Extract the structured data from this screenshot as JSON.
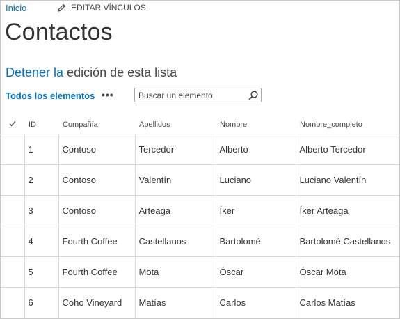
{
  "nav": {
    "home": "Inicio",
    "edit_links": "EDITAR VÍNCULOS"
  },
  "page": {
    "title": "Contactos",
    "stop_edit_link": "Detener la",
    "stop_edit_rest": " edición de esta lista"
  },
  "toolbar": {
    "view": "Todos los elementos",
    "more": "•••",
    "search_placeholder": "Buscar un elemento"
  },
  "table": {
    "columns": [
      "ID",
      "Compañía",
      "Apellidos",
      "Nombre",
      "Nombre_completo"
    ],
    "rows": [
      [
        "1",
        "Contoso",
        "Tercedor",
        "Alberto",
        "Alberto Tercedor"
      ],
      [
        "2",
        "Contoso",
        "Valentín",
        "Luciano",
        "Luciano Valentín"
      ],
      [
        "3",
        "Contoso",
        "Arteaga",
        "Íker",
        "Íker Arteaga"
      ],
      [
        "4",
        "Fourth Coffee",
        "Castellanos",
        "Bartolomé",
        "Bartolomé Castellanos"
      ],
      [
        "5",
        "Fourth Coffee",
        "Mota",
        "Óscar",
        "Óscar Mota"
      ],
      [
        "6",
        "Coho Vineyard",
        "Matías",
        "Carlos",
        "Carlos Matías"
      ]
    ]
  },
  "colors": {
    "accent": "#0072c6",
    "text": "#444444",
    "border": "#d8d8d8"
  },
  "icons": {
    "edit": "pencil-icon",
    "search": "magnifier-icon",
    "select_all": "checkmark-icon"
  }
}
